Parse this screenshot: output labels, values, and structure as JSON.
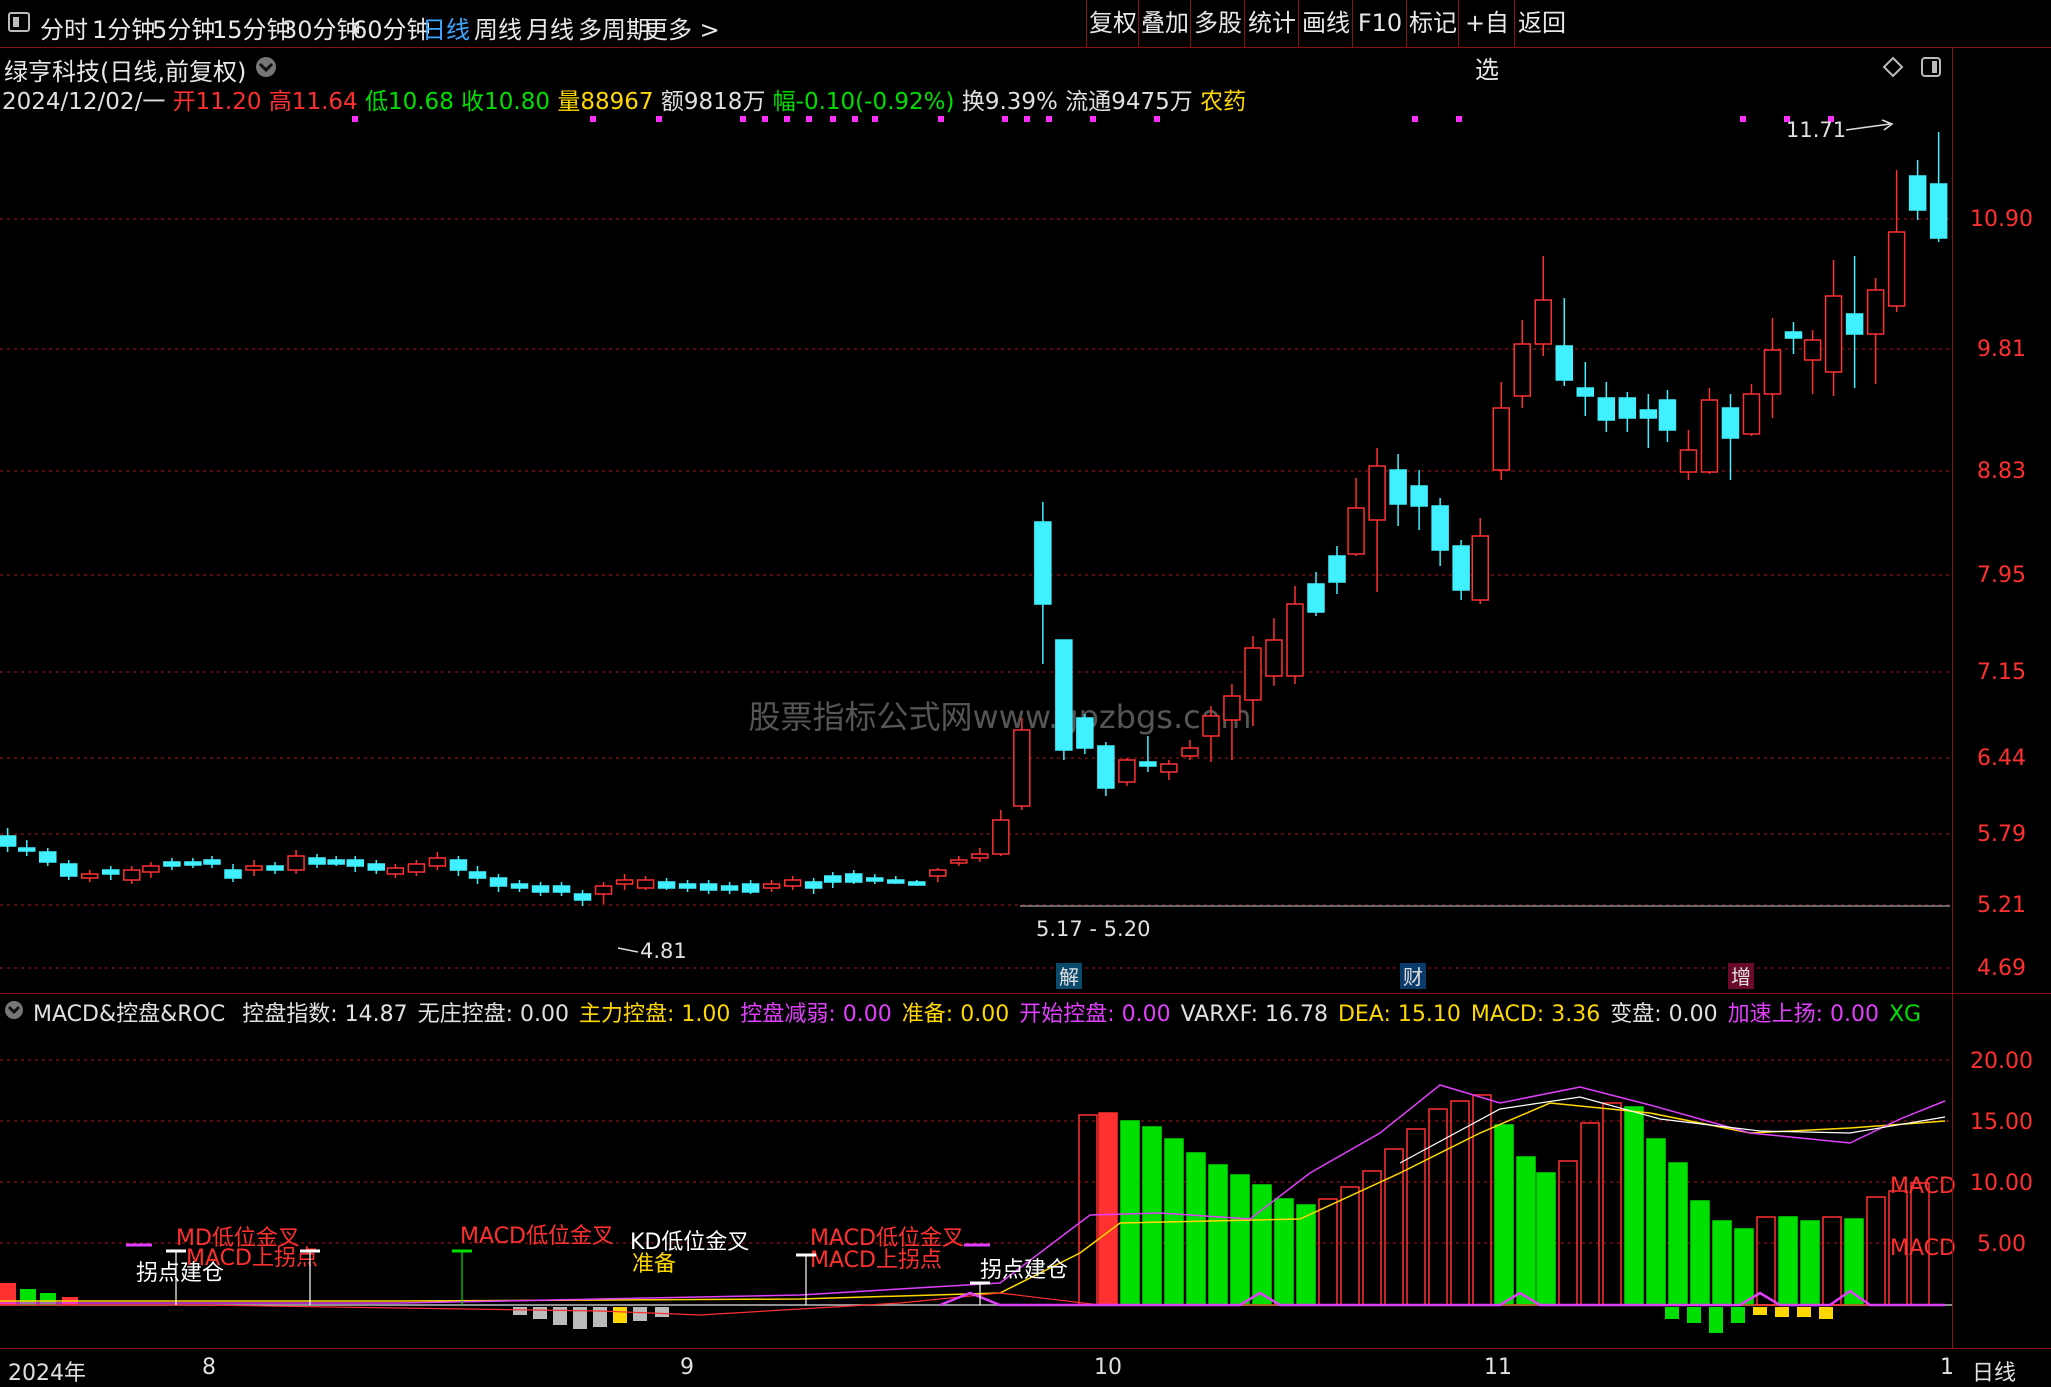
{
  "toolbar": {
    "periods": [
      "分时",
      "1分钟",
      "5分钟",
      "15分钟",
      "30分钟",
      "60分钟",
      "日线",
      "周线",
      "月线",
      "多周期",
      "更多 >"
    ],
    "active_index": 6,
    "right_buttons": [
      "复权",
      "叠加",
      "多股",
      "统计",
      "画线",
      "F10",
      "标记",
      "+自选",
      "返回"
    ]
  },
  "stock": {
    "title": "绿亨科技(日线,前复权)",
    "date": "2024/12/02/一",
    "open_label": "开",
    "open": "11.20",
    "high_label": "高",
    "high": "11.64",
    "low_label": "低",
    "low": "10.68",
    "close_label": "收",
    "close": "10.80",
    "volume_label": "量",
    "volume": "88967",
    "amount_label": "额",
    "amount": "9818万",
    "change_label": "幅",
    "change": "-0.10(-0.92%)",
    "turnover_label": "换",
    "turnover": "9.39%",
    "float_label": "流通",
    "float": "9475万",
    "sector": "农药"
  },
  "main_chart": {
    "y_ticks": [
      "10.90",
      "9.81",
      "8.83",
      "7.95",
      "7.15",
      "6.44",
      "5.79",
      "5.21",
      "4.69"
    ],
    "high_annotation": "11.71",
    "low_annotation": "4.81",
    "range_annotation": "5.17 - 5.20",
    "event_markers": [
      "解",
      "财",
      "增"
    ],
    "watermark": "股票指标公式网www.gpzbgs.com"
  },
  "indicator": {
    "name": "MACD&控盘&ROC",
    "items": [
      {
        "label": "控盘指数",
        "value": "14.87",
        "color": "#e0e0e0"
      },
      {
        "label": "无庄控盘",
        "value": "0.00",
        "color": "#e0e0e0"
      },
      {
        "label": "主力控盘",
        "value": "1.00",
        "color": "#ffd700"
      },
      {
        "label": "控盘减弱",
        "value": "0.00",
        "color": "#e040fb"
      },
      {
        "label": "准备",
        "value": "0.00",
        "color": "#ffd700"
      },
      {
        "label": "开始控盘",
        "value": "0.00",
        "color": "#e040fb"
      },
      {
        "label": "VARXF",
        "value": "16.78",
        "color": "#e0e0e0"
      },
      {
        "label": "DEA",
        "value": "15.10",
        "color": "#ffd700"
      },
      {
        "label": "MACD",
        "value": "3.36",
        "color": "#ffd700"
      },
      {
        "label": "变盘",
        "value": "0.00",
        "color": "#e0e0e0"
      },
      {
        "label": "加速上扬",
        "value": "0.00",
        "color": "#e040fb"
      },
      {
        "label": "XG",
        "value": "",
        "color": "#00e000"
      }
    ],
    "y_ticks": [
      "20.00",
      "15.00",
      "10.00",
      "5.00"
    ],
    "signal_labels": [
      "拐点建仓",
      "MD低位金叉",
      "MACD上拐点",
      "MACD低位金叉",
      "KD低位金叉",
      "准备",
      "MACD低位金叉",
      "MACD上拐点",
      "拐点建仓",
      "MACD",
      "MACD"
    ]
  },
  "x_axis": {
    "labels": [
      "2024年",
      "8",
      "9",
      "10",
      "11",
      "1"
    ],
    "period_label": "日线"
  },
  "colors": {
    "up": "#ff3030",
    "down": "#40f0ff",
    "grid": "#8a1010"
  }
}
